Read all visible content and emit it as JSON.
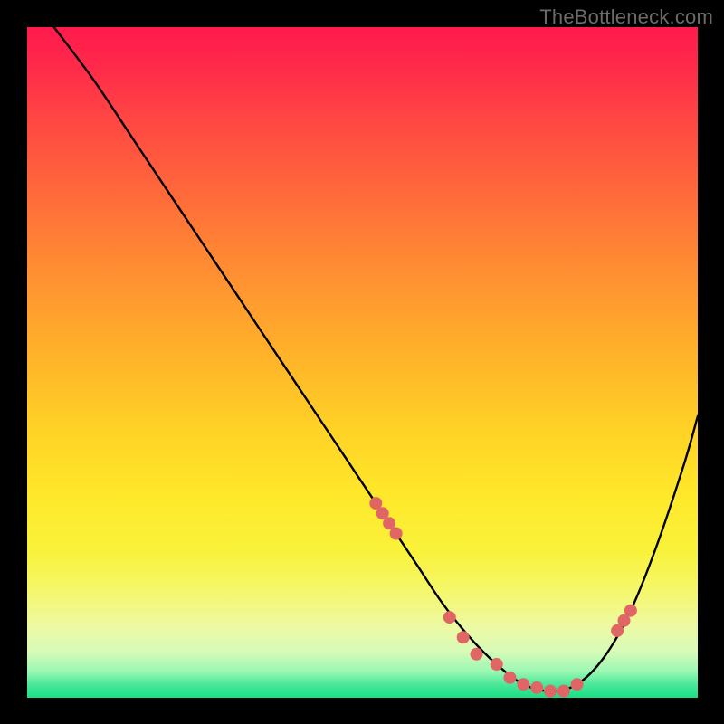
{
  "watermark": "TheBottleneck.com",
  "chart_data": {
    "type": "line",
    "title": "",
    "xlabel": "",
    "ylabel": "",
    "xlim": [
      0,
      100
    ],
    "ylim": [
      0,
      100
    ],
    "grid": false,
    "legend": false,
    "series": [
      {
        "name": "curve",
        "x": [
          4,
          10,
          16,
          22,
          28,
          34,
          40,
          46,
          52,
          58,
          62,
          66,
          70,
          74,
          78,
          82,
          86,
          90,
          94,
          98,
          100
        ],
        "y": [
          100,
          92,
          83,
          74,
          65,
          56,
          47,
          38,
          29,
          20,
          14,
          9,
          5,
          2,
          1,
          2,
          6,
          13,
          23,
          35,
          42
        ]
      }
    ],
    "scatter_points": {
      "name": "markers",
      "x": [
        52,
        53,
        54,
        55,
        63,
        65,
        67,
        70,
        72,
        74,
        76,
        78,
        80,
        82,
        88,
        89,
        90
      ],
      "y": [
        29,
        27.5,
        26,
        24.5,
        12,
        9,
        6.5,
        5,
        3,
        2,
        1.5,
        1,
        1,
        2,
        10,
        11.5,
        13
      ],
      "color": "#e06666",
      "radius": 7
    }
  }
}
